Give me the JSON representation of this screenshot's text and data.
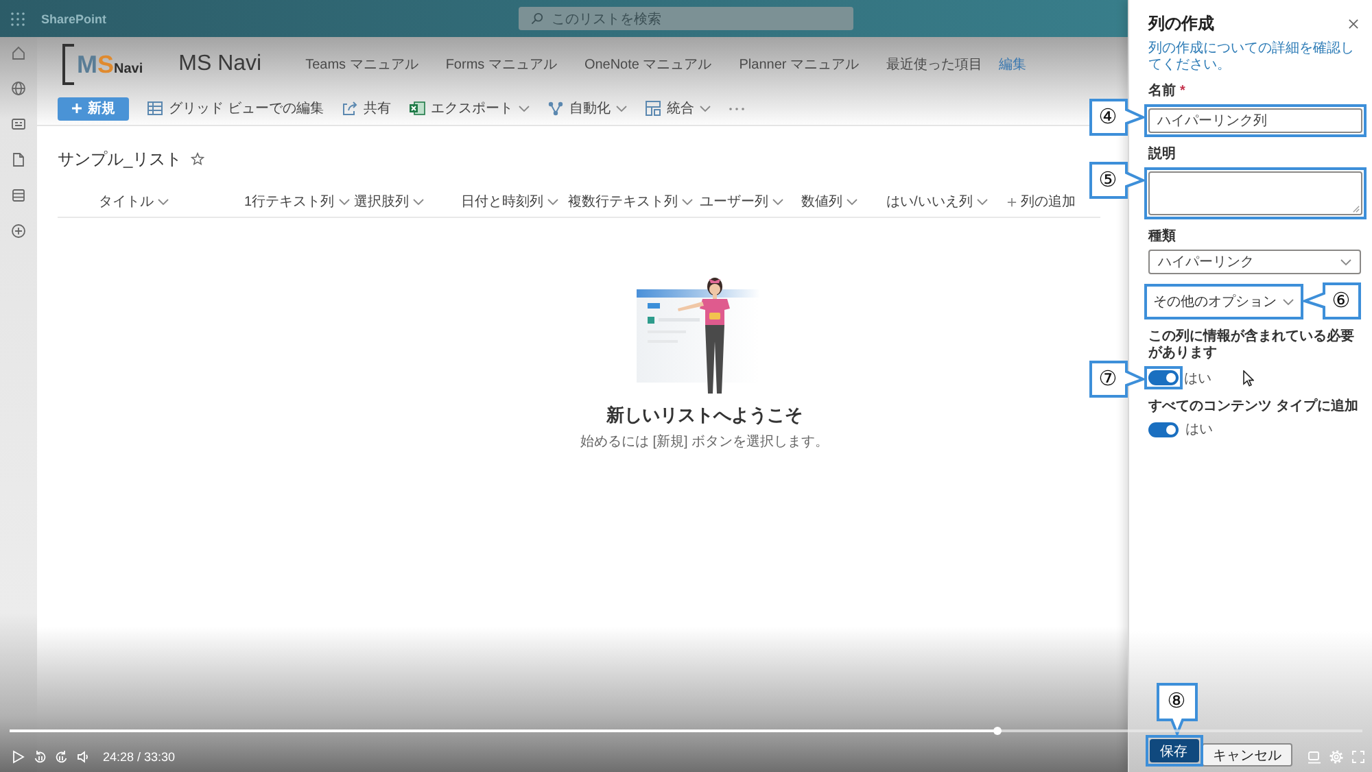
{
  "top_bar": {
    "app_name": "SharePoint",
    "search": {
      "placeholder": "このリストを検索"
    }
  },
  "site": {
    "logo": {
      "parts": [
        {
          "text": "M",
          "kind": "initial"
        },
        {
          "text": "S",
          "kind": "initial"
        },
        {
          "text": "Navi",
          "kind": "word"
        }
      ]
    },
    "title": "MS Navi",
    "nav": [
      {
        "label": "Teams マニュアル"
      },
      {
        "label": "Forms マニュアル"
      },
      {
        "label": "OneNote マニュアル"
      },
      {
        "label": "Planner マニュアル"
      },
      {
        "label": "最近使った項目"
      }
    ],
    "edit_link": "編集"
  },
  "command_bar": {
    "new_button": "新規",
    "commands": [
      {
        "kind": "grid",
        "label": "グリッド ビューでの編集",
        "dropdown": false
      },
      {
        "kind": "share",
        "label": "共有",
        "dropdown": false
      },
      {
        "kind": "export",
        "label": "エクスポート",
        "dropdown": true
      },
      {
        "kind": "automate",
        "label": "自動化",
        "dropdown": true
      },
      {
        "kind": "integrate",
        "label": "統合",
        "dropdown": true
      }
    ]
  },
  "list": {
    "title": "サンプル_リスト",
    "favorite": false,
    "columns": [
      {
        "kind": "column",
        "label": "タイトル"
      },
      {
        "kind": "column",
        "label": "1行テキスト列"
      },
      {
        "kind": "column",
        "label": "選択肢列"
      },
      {
        "kind": "column",
        "label": "日付と時刻列"
      },
      {
        "kind": "column",
        "label": "複数行テキスト列"
      },
      {
        "kind": "column",
        "label": "ユーザー列"
      },
      {
        "kind": "column",
        "label": "数値列"
      },
      {
        "kind": "column",
        "label": "はい/いいえ列"
      },
      {
        "kind": "add",
        "label": "列の追加"
      }
    ]
  },
  "empty_state": {
    "title": "新しいリストへようこそ",
    "message": "始めるには [新規] ボタンを選択します。"
  },
  "panel": {
    "title": "列の作成",
    "description": "列の作成についての詳細を確認してください。",
    "fields": [
      {
        "kind": "text",
        "label": "名前",
        "required_mark": "*",
        "value": "ハイパーリンク列",
        "callout": "④"
      },
      {
        "kind": "textarea",
        "label": "説明",
        "callout": "⑤"
      },
      {
        "kind": "select",
        "label": "種類",
        "value": "ハイパーリンク"
      },
      {
        "kind": "options",
        "label": "その他のオプション",
        "callout": "⑥"
      },
      {
        "kind": "toggle",
        "label": "この列に情報が含まれている必要があります",
        "on": true,
        "state_text": "はい",
        "callout": "⑦"
      },
      {
        "kind": "toggle",
        "label": "すべてのコンテンツ タイプに追加",
        "on": true,
        "state_text": "はい"
      }
    ],
    "buttons": [
      {
        "label": "保存",
        "primary": true,
        "callout": "⑧"
      },
      {
        "label": "キャンセル",
        "primary": false
      }
    ]
  },
  "player": {
    "time": "24:28 / 33:30",
    "level": 0.73
  }
}
